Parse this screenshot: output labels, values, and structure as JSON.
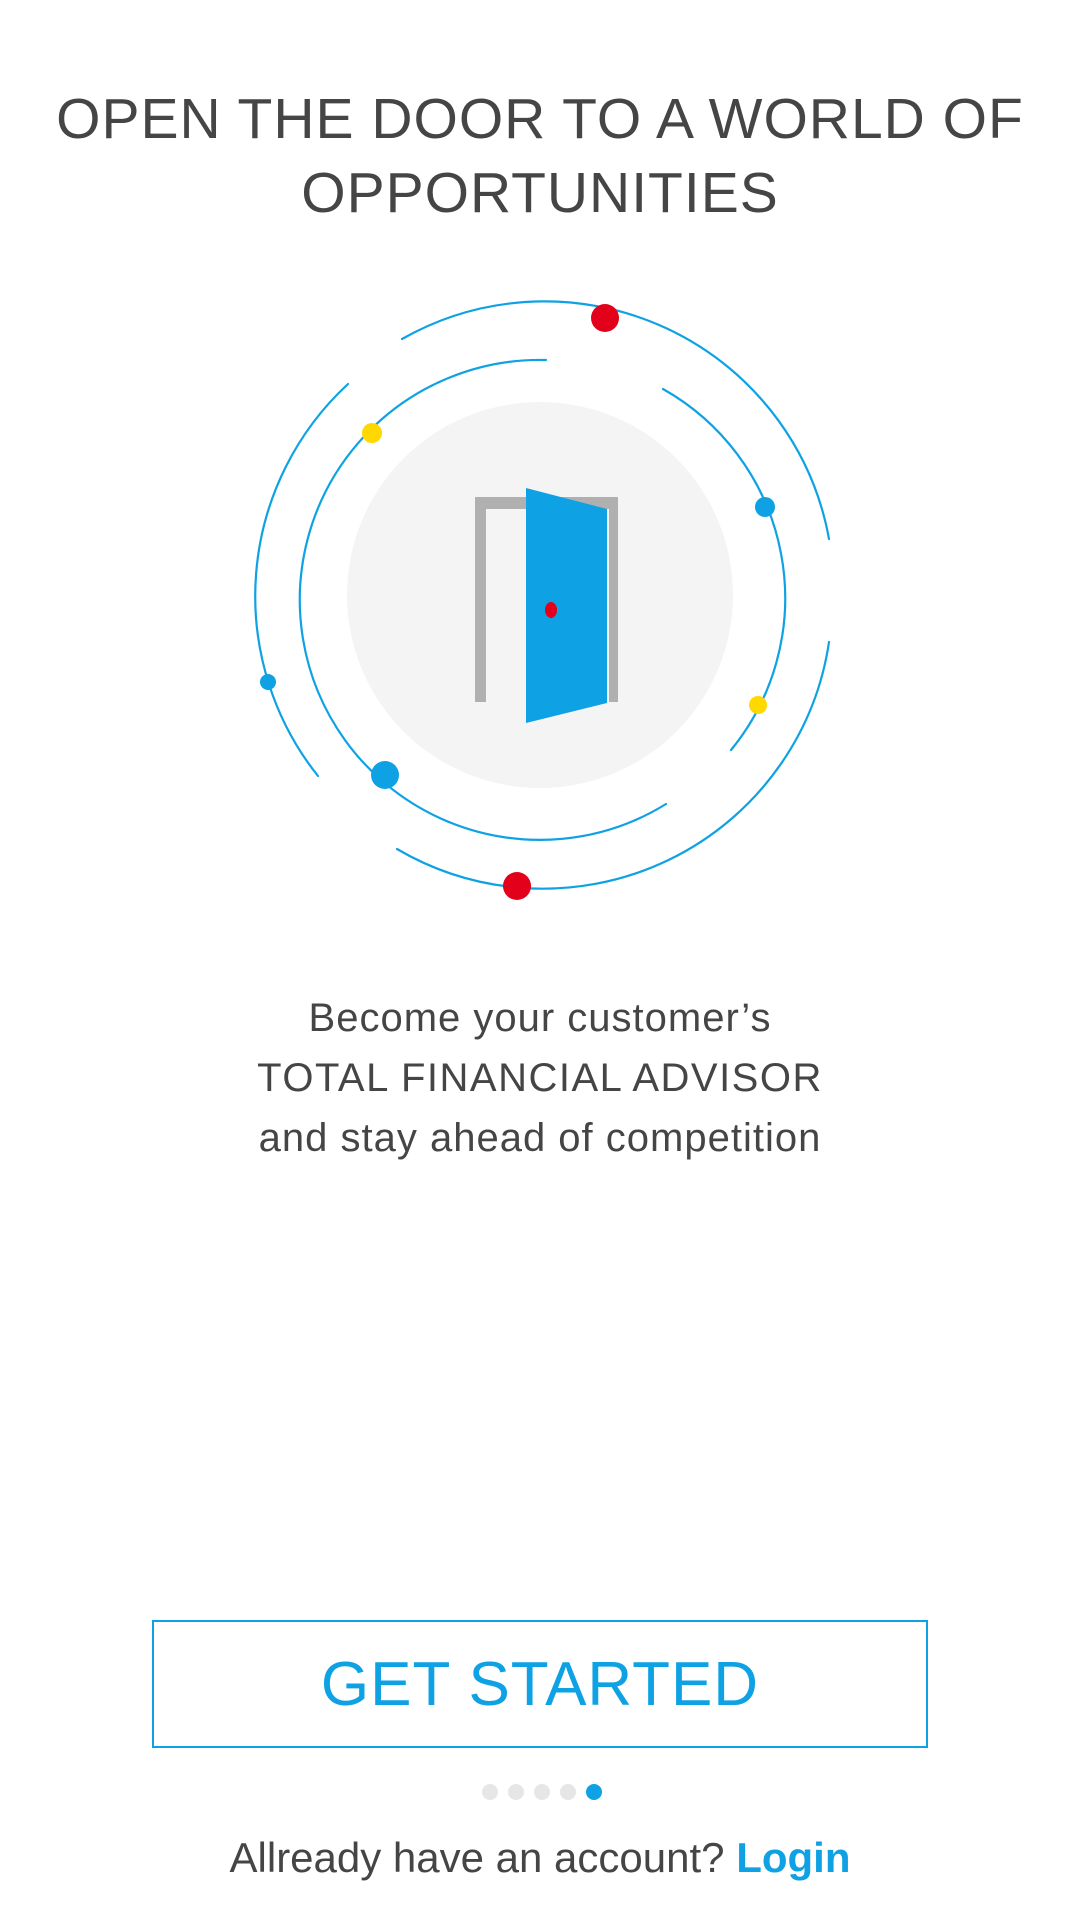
{
  "headline": {
    "line1": "OPEN THE DOOR TO A WORLD OF",
    "line2": "OPPORTUNITIES"
  },
  "illustration": {
    "icon": "open-door-icon",
    "colors": {
      "ring": "#0ea2e4",
      "door": "#0ea2e4",
      "frame": "#b0b0b0",
      "knob": "#e2001a",
      "halo": "#f4f4f4",
      "accent_red": "#e2001a",
      "accent_yellow": "#ffd800",
      "accent_blue": "#0ea2e4"
    }
  },
  "tagline": {
    "line1": "Become your customer’s",
    "line2": "TOTAL FINANCIAL ADVISOR",
    "line3": "and stay ahead of competition"
  },
  "cta": {
    "label": "GET STARTED"
  },
  "pager": {
    "total": 5,
    "active_index": 4
  },
  "login": {
    "prompt": "Allready have an account?",
    "link_label": "Login"
  },
  "colors": {
    "accent": "#0ea2e4",
    "text": "#454545",
    "inactive_dot": "#e6e6e6"
  }
}
